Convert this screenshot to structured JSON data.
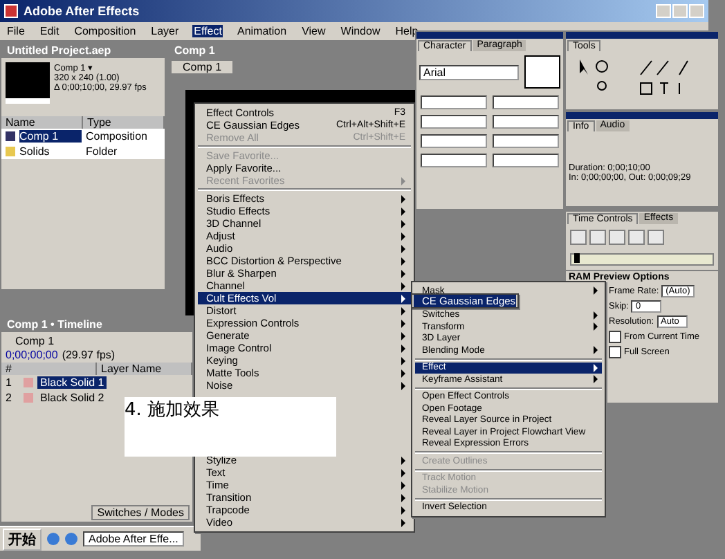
{
  "app_window": {
    "title": "Adobe After Effects"
  },
  "menubar": [
    {
      "label": "File",
      "selected": false
    },
    {
      "label": "Edit",
      "selected": false
    },
    {
      "label": "Composition",
      "selected": false
    },
    {
      "label": "Layer",
      "selected": false
    },
    {
      "label": "Effect",
      "selected": true
    },
    {
      "label": "Animation",
      "selected": false
    },
    {
      "label": "View",
      "selected": false
    },
    {
      "label": "Window",
      "selected": false
    },
    {
      "label": "Help",
      "selected": false
    }
  ],
  "project": {
    "title": "Untitled Project.aep",
    "info": [
      "Comp 1 ▾",
      "320 x 240 (1.00)",
      "Δ 0;00;10;00, 29.97 fps"
    ],
    "columns": [
      "Name",
      "Type"
    ],
    "rows": [
      {
        "name": "Comp 1",
        "type": "Composition",
        "kind": "comp",
        "selected": true
      },
      {
        "name": "Solids",
        "type": "Folder",
        "kind": "folder",
        "selected": false
      }
    ]
  },
  "comp": {
    "title": "Comp 1",
    "tab": "Comp 1"
  },
  "character": {
    "tabs": [
      {
        "label": "Character",
        "selected": true
      },
      {
        "label": "Paragraph",
        "selected": false
      }
    ],
    "font": "Arial"
  },
  "tools": {
    "tab": "Tools"
  },
  "info": {
    "tabs": [
      {
        "label": "Info",
        "selected": true
      },
      {
        "label": "Audio",
        "selected": false
      }
    ],
    "lines": [
      "Duration: 0;00;10;00",
      "In: 0;00;00;00, Out: 0;00;09;29"
    ]
  },
  "time_controls": {
    "tabs": [
      {
        "label": "Time Controls",
        "selected": true
      },
      {
        "label": "Effects",
        "selected": false
      }
    ],
    "heading": "RAM Preview Options",
    "slider": {
      "level": 0.02
    },
    "fields": [
      {
        "label": "Frame Rate:",
        "value": "(Auto)"
      },
      {
        "label": "Skip:",
        "value": "0"
      },
      {
        "label": "Resolution:",
        "value": "Auto"
      }
    ],
    "options": [
      {
        "label": "From Current Time",
        "checked": false
      },
      {
        "label": "Full Screen",
        "checked": false
      }
    ]
  },
  "effect_menu": {
    "top": [
      {
        "label": "Effect Controls",
        "shortcut": "F3",
        "disabled": false
      },
      {
        "label": "CE Gaussian Edges",
        "shortcut": "Ctrl+Alt+Shift+E",
        "disabled": false
      },
      {
        "label": "Remove All",
        "shortcut": "Ctrl+Shift+E",
        "disabled": true
      }
    ],
    "favorites": [
      {
        "label": "Save Favorite...",
        "disabled": true,
        "submenu": false
      },
      {
        "label": "Apply Favorite...",
        "disabled": false,
        "submenu": false
      },
      {
        "label": "Recent Favorites",
        "disabled": true,
        "submenu": true
      }
    ],
    "categories_above": [
      {
        "label": "Boris Effects",
        "selected": false
      },
      {
        "label": "Studio Effects",
        "selected": false
      },
      {
        "label": "3D Channel",
        "selected": false
      },
      {
        "label": "Adjust",
        "selected": false
      },
      {
        "label": "Audio",
        "selected": false
      },
      {
        "label": "BCC Distortion & Perspective",
        "selected": false
      },
      {
        "label": "Blur & Sharpen",
        "selected": false
      },
      {
        "label": "Channel",
        "selected": false
      },
      {
        "label": "Cult Effects Vol",
        "selected": true
      },
      {
        "label": "Distort",
        "selected": false
      },
      {
        "label": "Expression Controls",
        "selected": false
      },
      {
        "label": "Generate",
        "selected": false
      },
      {
        "label": "Image Control",
        "selected": false
      },
      {
        "label": "Keying",
        "selected": false
      },
      {
        "label": "Matte Tools",
        "selected": false
      },
      {
        "label": "Noise",
        "selected": false
      }
    ],
    "categories_below": [
      {
        "label": "Stylize",
        "selected": false
      },
      {
        "label": "Text",
        "selected": false
      },
      {
        "label": "Time",
        "selected": false
      },
      {
        "label": "Transition",
        "selected": false
      },
      {
        "label": "Trapcode",
        "selected": false
      },
      {
        "label": "Video",
        "selected": false
      }
    ]
  },
  "submenu": {
    "label": "CE Gaussian Edges",
    "selected": true
  },
  "context_menu": {
    "groups": [
      [
        {
          "label": "Mask",
          "submenu": true,
          "disabled": false,
          "selected": false
        },
        {
          "label": "Switches",
          "submenu": true,
          "disabled": false,
          "selected": false
        },
        {
          "label": "Transform",
          "submenu": true,
          "disabled": false,
          "selected": false
        },
        {
          "label": "3D Layer",
          "submenu": false,
          "disabled": false,
          "selected": false
        },
        {
          "label": "Blending Mode",
          "submenu": true,
          "disabled": false,
          "selected": false
        }
      ],
      [
        {
          "label": "Effect",
          "submenu": true,
          "disabled": false,
          "selected": true
        },
        {
          "label": "Keyframe Assistant",
          "submenu": true,
          "disabled": false,
          "selected": false
        }
      ],
      [
        {
          "label": "Open Effect Controls",
          "submenu": false,
          "disabled": false,
          "selected": false
        },
        {
          "label": "Open Footage",
          "submenu": false,
          "disabled": false,
          "selected": false
        },
        {
          "label": "Reveal Layer Source in Project",
          "submenu": false,
          "disabled": false,
          "selected": false
        },
        {
          "label": "Reveal Layer in Project Flowchart View",
          "submenu": false,
          "disabled": false,
          "selected": false
        },
        {
          "label": "Reveal Expression Errors",
          "submenu": false,
          "disabled": false,
          "selected": false
        }
      ],
      [
        {
          "label": "Create Outlines",
          "submenu": false,
          "disabled": true,
          "selected": false
        }
      ],
      [
        {
          "label": "Track Motion",
          "submenu": false,
          "disabled": true,
          "selected": false
        },
        {
          "label": "Stabilize Motion",
          "submenu": false,
          "disabled": true,
          "selected": false
        }
      ],
      [
        {
          "label": "Invert Selection",
          "submenu": false,
          "disabled": false,
          "selected": false
        }
      ]
    ]
  },
  "timeline": {
    "title": "Comp 1 • Timeline",
    "tab": "Comp 1",
    "time": "0;00;00;00",
    "fps": "(29.97 fps)",
    "columns": [
      "#",
      "Layer Name"
    ],
    "layers": [
      {
        "number": "1",
        "name": "Black Solid 1",
        "selected": true
      },
      {
        "number": "2",
        "name": "Black Solid 2",
        "selected": false
      }
    ],
    "footer": "Switches / Modes"
  },
  "caption": "4. 施加效果",
  "taskbar": {
    "start": "开始",
    "tasks": [
      "Adobe After Effe..."
    ]
  }
}
